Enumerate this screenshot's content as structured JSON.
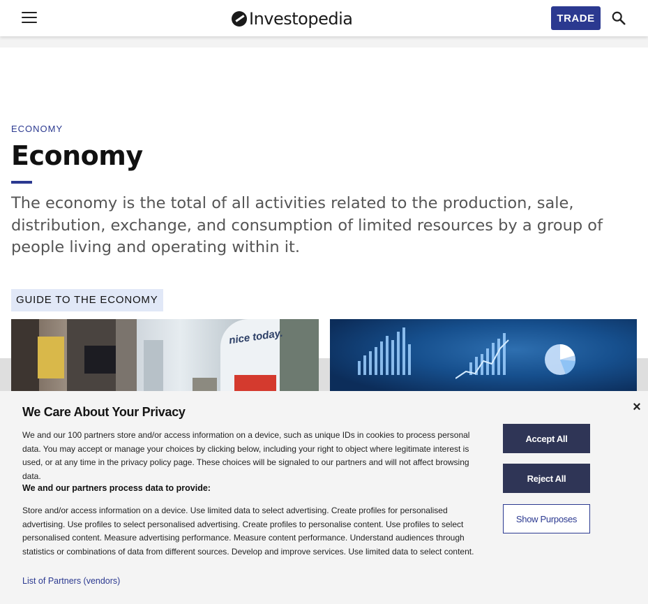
{
  "header": {
    "logo_text": "Investopedia",
    "trade_label": "TRADE"
  },
  "article": {
    "kicker": "ECONOMY",
    "title": "Economy",
    "dek": "The economy is the total of all activities related to the production, sale, distribution, exchange, and consumption of limited resources by a group of people living and operating within it.",
    "section_label": "GUIDE TO THE ECONOMY",
    "image_left_sign": "nice today."
  },
  "privacy": {
    "title": "We Care About Your Privacy",
    "body": "We and our 100 partners store and/or access information on a device, such as unique IDs in cookies to process personal data. You may accept or manage your choices by clicking below, including your right to object where legitimate interest is used, or at any time in the privacy policy page. These choices will be signaled to our partners and will not affect browsing data.",
    "subhead": "We and our partners process data to provide:",
    "purposes": "Store and/or access information on a device. Use limited data to select advertising. Create profiles for personalised advertising. Use profiles to select personalised advertising. Create profiles to personalise content. Use profiles to select personalised content. Measure advertising performance. Measure content performance. Understand audiences through statistics or combinations of data from different sources. Develop and improve services. Use limited data to select content.",
    "partners_link": "List of Partners (vendors)",
    "close": "×",
    "accept_label": "Accept All",
    "reject_label": "Reject All",
    "show_label": "Show Purposes"
  },
  "colors": {
    "brand_blue": "#2b3990",
    "button_dark": "#2f3556",
    "guide_bg": "#e1e8f7"
  },
  "icons": [
    "hamburger-menu-icon",
    "investopedia-logo-icon",
    "search-icon",
    "close-icon"
  ]
}
